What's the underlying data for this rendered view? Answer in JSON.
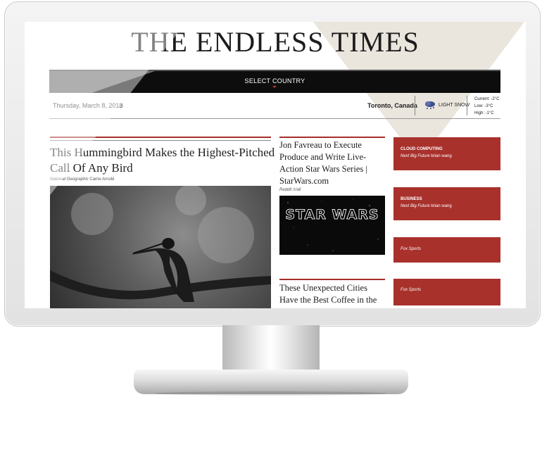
{
  "masthead": {
    "title": "THE ENDLESS TIMES"
  },
  "nav": {
    "select_country": "SELECT COUNTRY"
  },
  "infobar": {
    "date": "Thursday, March 8, 2018",
    "location": "Toronto, Canada",
    "condition": "LIGHT SNOW",
    "current": "Current: -2°C",
    "low": "Low: -3°C",
    "high": "High: -1°C",
    "weather_icon": "snow-cloud-icon"
  },
  "main_story": {
    "title": "This Hummingbird Makes the Highest-Pitched Call Of Any Bird",
    "source": "National Geographic",
    "author": "Carrie Arnold",
    "image": "hummingbird-photo"
  },
  "middle": [
    {
      "title": "Jon Favreau to Execute Produce and Write Live-Action Star Wars Series | StarWars.com",
      "source": "Reddit /r/all",
      "image_text": "STAR WARS"
    },
    {
      "title": "These Unexpected Cities Have the Best Coffee in the"
    }
  ],
  "sidebar": [
    {
      "category": "CLOUD COMPUTING",
      "source": "Next Big Future",
      "author": "brian wang"
    },
    {
      "category": "BUSINESS",
      "source": "Next Big Future",
      "author": "brian wang"
    },
    {
      "category": "",
      "source": "Fox Sports",
      "author": ""
    },
    {
      "category": "",
      "source": "Fox Sports",
      "author": ""
    }
  ],
  "colors": {
    "accent": "#a8312c",
    "nav_bg": "#0d0d0d",
    "triangle": "#e6e1d7"
  }
}
